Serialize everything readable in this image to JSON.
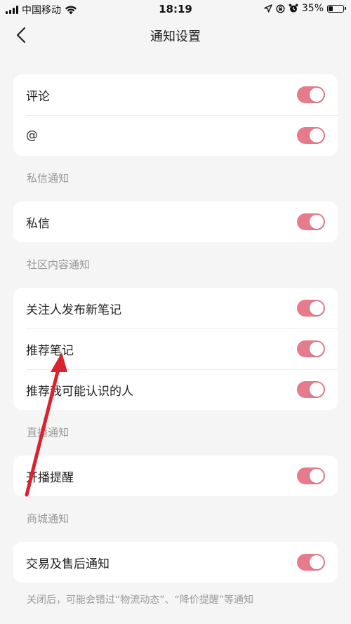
{
  "status_bar": {
    "carrier": "中国移动",
    "time": "18:19",
    "battery_level": "35%",
    "battery_fraction": 0.35
  },
  "nav": {
    "title": "通知设置",
    "back_icon": "chevron-left-icon"
  },
  "colors": {
    "toggle_on": "#e57b8b",
    "annotation_arrow": "#d9232e"
  },
  "sections": [
    {
      "title": "",
      "items": [
        {
          "label": "评论",
          "enabled": true
        },
        {
          "label": "@",
          "enabled": true
        }
      ]
    },
    {
      "title": "私信通知",
      "items": [
        {
          "label": "私信",
          "enabled": true
        }
      ]
    },
    {
      "title": "社区内容通知",
      "items": [
        {
          "label": "关注人发布新笔记",
          "enabled": true
        },
        {
          "label": "推荐笔记",
          "enabled": true
        },
        {
          "label": "推荐我可能认识的人",
          "enabled": true
        }
      ]
    },
    {
      "title": "直播通知",
      "items": [
        {
          "label": "开播提醒",
          "enabled": true
        }
      ]
    },
    {
      "title": "商城通知",
      "items": [
        {
          "label": "交易及售后通知",
          "enabled": true
        }
      ]
    }
  ],
  "footer_note": "关闭后，可能会错过“物流动态”、“降价提醒”等通知"
}
